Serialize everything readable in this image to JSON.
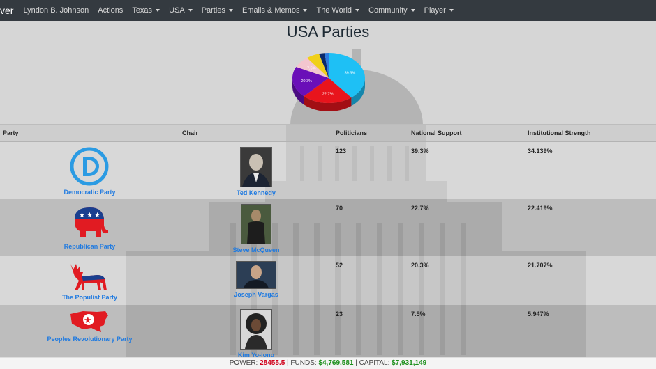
{
  "nav": {
    "brand": "ver",
    "items": [
      {
        "label": "Lyndon B. Johnson",
        "dropdown": false
      },
      {
        "label": "Actions",
        "dropdown": false
      },
      {
        "label": "Texas",
        "dropdown": true
      },
      {
        "label": "USA",
        "dropdown": true
      },
      {
        "label": "Parties",
        "dropdown": true
      },
      {
        "label": "Emails & Memos",
        "dropdown": true
      },
      {
        "label": "The World",
        "dropdown": true
      },
      {
        "label": "Community",
        "dropdown": true
      },
      {
        "label": "Player",
        "dropdown": true
      }
    ]
  },
  "page": {
    "title": "USA Parties"
  },
  "chart_data": {
    "type": "pie",
    "slices": [
      {
        "label": "39.3%",
        "value": 39.3,
        "color": "#1ec0f5"
      },
      {
        "label": "22.7%",
        "value": 22.7,
        "color": "#e8141c"
      },
      {
        "label": "20.3%",
        "value": 20.3,
        "color": "#6a0fb8"
      },
      {
        "label": "7.5%",
        "value": 7.5,
        "color": "#f3c6cf"
      },
      {
        "label": "",
        "value": 5.9,
        "color": "#f0d01a"
      },
      {
        "label": "",
        "value": 2.5,
        "color": "#0b2a6b"
      },
      {
        "label": "",
        "value": 1.8,
        "color": "#2e7be0"
      }
    ]
  },
  "table": {
    "headers": [
      "Party",
      "Chair",
      "Politicians",
      "National Support",
      "Institutional Strength"
    ],
    "rows": [
      {
        "party": "Democratic Party",
        "logo": "democratic-d-logo",
        "chair": "Ted Kennedy",
        "politicians": "123",
        "support": "39.3%",
        "strength": "34.139%"
      },
      {
        "party": "Republican Party",
        "logo": "republican-elephant-logo",
        "chair": "Steve McQueen",
        "politicians": "70",
        "support": "22.7%",
        "strength": "22.419%"
      },
      {
        "party": "The Populist Party",
        "logo": "populist-moose-logo",
        "chair": "Joseph Vargas",
        "politicians": "52",
        "support": "20.3%",
        "strength": "21.707%"
      },
      {
        "party": "Peoples Revolutionary Party",
        "logo": "usa-map-star-logo",
        "chair": "Kim Yo-jong",
        "politicians": "23",
        "support": "7.5%",
        "strength": "5.947%"
      }
    ]
  },
  "footer": {
    "power_label": "POWER:",
    "power_value": "28455.5",
    "funds_label": "| FUNDS:",
    "funds_value": "$4,769,581",
    "capital_label": "| CAPITAL:",
    "capital_value": "$7,931,149"
  },
  "colors": {
    "navbar": "#343a40",
    "link": "#1f7ae0",
    "power": "#d0021b",
    "money": "#1a8f1a"
  }
}
